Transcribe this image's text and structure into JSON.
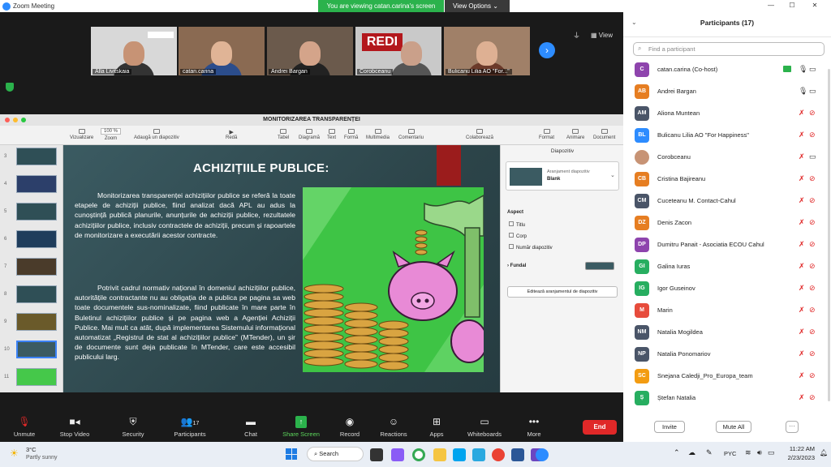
{
  "window": {
    "title": "Zoom Meeting",
    "viewing_banner": "You are viewing catan.carina's screen",
    "view_options": "View Options",
    "view_label": "View"
  },
  "video_tiles": [
    {
      "name": "Alla Livitskaia"
    },
    {
      "name": "catan.carina"
    },
    {
      "name": "Andrei Bargan"
    },
    {
      "name": "Corobceanu"
    },
    {
      "name": "Bulicanu Lilia AO \"For...\""
    }
  ],
  "keynote": {
    "title": "MONITORIZAREA TRANSPARENȚEI",
    "toolbar": [
      "Vizualizare",
      "Zoom",
      "Adaugă un diapozitiv",
      "Redă",
      "Tabel",
      "Diagramă",
      "Text",
      "Formă",
      "Multimedia",
      "Comentariu",
      "Colaborează",
      "Format",
      "Animare",
      "Document"
    ],
    "zoom_value": "100 %",
    "thumb_numbers": [
      "3",
      "4",
      "5",
      "6",
      "7",
      "8",
      "9",
      "10",
      "11"
    ],
    "slide": {
      "title": "ACHIZIȚIILE PUBLICE:",
      "paragraph1": "Monitorizarea transparenței achizițiilor publice se referă la toate etapele de achiziții publice, fiind analizat dacă APL au adus la cunoștință publică planurile, anunțurile de achiziții publice, rezultatele achizițiilor publice, inclusiv contractele de achiziții, precum și rapoartele de monitorizare a executării acestor contracte.",
      "paragraph2": "Potrivit cadrul normativ național în domeniul achizițiilor publice, autoritățile contractante nu au obligația de a publica pe pagina sa web toate documentele sus-nominalizate, fiind publicate în mare parte în Buletinul achizițiilor publice și pe pagina web a Agenției Achiziții Publice. Mai mult ca atât, după implementarea Sistemului informațional automatizat „Registrul de stat al achizițiilor publice” (MTender), un șir de documente sunt deja publicate în MTender, care este accesibil publicului larg."
    },
    "inspector": {
      "header": "Diapozitiv",
      "layout_label": "Aranjament diapozitiv",
      "layout_value": "Blank",
      "aspect_label": "Aspect",
      "checkboxes": [
        "Titlu",
        "Corp",
        "Număr diapozitiv"
      ],
      "background_label": "Fundal",
      "edit_button": "Editează aranjamentul de diapozitiv",
      "background_color": "#3b5b62"
    }
  },
  "controls": [
    {
      "label": "Unmute",
      "icon": "mic-muted-icon"
    },
    {
      "label": "Stop Video",
      "icon": "video-icon"
    },
    {
      "label": "Security",
      "icon": "shield-icon"
    },
    {
      "label": "Participants",
      "icon": "participants-icon",
      "count": "17"
    },
    {
      "label": "Chat",
      "icon": "chat-icon"
    },
    {
      "label": "Share Screen",
      "icon": "share-screen-icon"
    },
    {
      "label": "Record",
      "icon": "record-icon"
    },
    {
      "label": "Reactions",
      "icon": "reactions-icon"
    },
    {
      "label": "Apps",
      "icon": "apps-icon"
    },
    {
      "label": "Whiteboards",
      "icon": "whiteboard-icon"
    },
    {
      "label": "More",
      "icon": "more-icon"
    }
  ],
  "end_button": "End",
  "participants_panel": {
    "header": "Participants (17)",
    "search_placeholder": "Find a participant",
    "participants": [
      {
        "initials": "C",
        "name": "catan.carina (Co-host)",
        "color": "#8e44ad"
      },
      {
        "initials": "AB",
        "name": "Andrei Bargan",
        "color": "#e67e22"
      },
      {
        "initials": "AM",
        "name": "Aliona Muntean",
        "color": "#4a5568"
      },
      {
        "initials": "BL",
        "name": "Bulicanu Lilia AO \"For Happiness\"",
        "color": "#2d8cff"
      },
      {
        "initials": "",
        "name": "Corobceanu",
        "color": "#c0392b"
      },
      {
        "initials": "CB",
        "name": "Cristina Bajireanu",
        "color": "#e67e22"
      },
      {
        "initials": "CM",
        "name": "Cuceteanu M. Contact-Cahul",
        "color": "#4a5568"
      },
      {
        "initials": "DZ",
        "name": "Denis Zacon",
        "color": "#e67e22"
      },
      {
        "initials": "DP",
        "name": "Dumitru Panait - Asociatia ECOU Cahul",
        "color": "#8e44ad"
      },
      {
        "initials": "GI",
        "name": "Galina Iuras",
        "color": "#27ae60"
      },
      {
        "initials": "IG",
        "name": "Igor Guseinov",
        "color": "#27ae60"
      },
      {
        "initials": "M",
        "name": "Marin",
        "color": "#e74c3c"
      },
      {
        "initials": "NM",
        "name": "Natalia Mogildea",
        "color": "#4a5568"
      },
      {
        "initials": "NP",
        "name": "Natalia Ponomariov",
        "color": "#4a5568"
      },
      {
        "initials": "SC",
        "name": "Snejana Caledji_Pro_Europa_team",
        "color": "#f39c12"
      },
      {
        "initials": "Ș",
        "name": "Ștefan Natalia",
        "color": "#27ae60"
      }
    ],
    "invite": "Invite",
    "mute_all": "Mute All",
    "more": "···"
  },
  "taskbar": {
    "weather_temp": "3°C",
    "weather_desc": "Partly sunny",
    "search": "Search",
    "language": "PYC",
    "time": "11:22 AM",
    "date": "2/23/2023"
  }
}
